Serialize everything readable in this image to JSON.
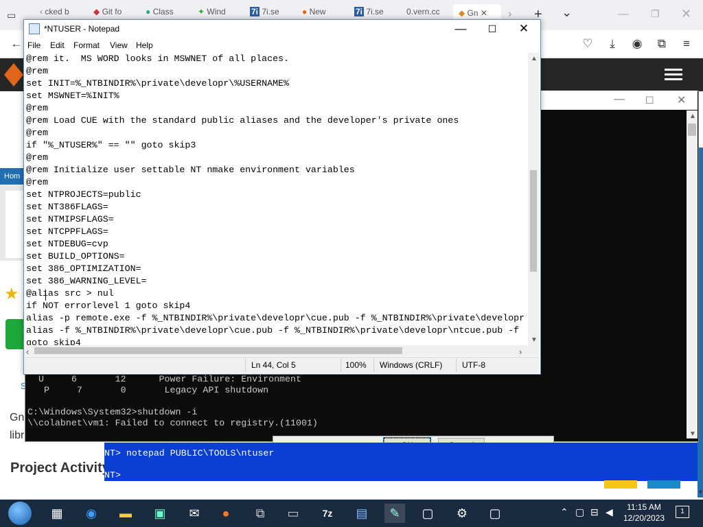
{
  "browser": {
    "tabs": [
      {
        "label": "cked b",
        "icon": "tab-favicon"
      },
      {
        "label": "Git fo",
        "icon": "github-icon"
      },
      {
        "label": "Class",
        "icon": "globe-icon"
      },
      {
        "label": "Wind",
        "icon": "leaf-icon"
      },
      {
        "label": "7i.se",
        "icon": "7z-icon"
      },
      {
        "label": "New",
        "icon": "firefox-icon"
      },
      {
        "label": "7i.se",
        "icon": "7z-icon"
      },
      {
        "label": "0.vern.cc",
        "icon": "tab-favicon"
      },
      {
        "label": "Gn",
        "icon": "gnu-icon"
      }
    ],
    "new_tab": "+",
    "tab_list": "⌄"
  },
  "background_page": {
    "home_link": "Hom",
    "s_link": "S",
    "gnu_text": "Gnu",
    "libr_text": "libr",
    "project_activity": "Project Activity"
  },
  "cmd": {
    "lines": [
      "  U     6       12      Power Failure: Environment",
      "   P     7       0       Legacy API shutdown",
      "",
      "C:\\Windows\\System32>shutdown -i",
      "\\\\colabnet\\vm1: Failed to connect to registry.(11001)"
    ]
  },
  "nt_console": {
    "line1": "NT> notepad PUBLIC\\TOOLS\\ntuser",
    "line2": "NT>"
  },
  "dialog": {
    "ok": "OK",
    "cancel": "Cancel"
  },
  "notepad": {
    "title": "*NTUSER - Notepad",
    "menu": [
      "File",
      "Edit",
      "Format",
      "View",
      "Help"
    ],
    "lines": [
      "@rem it.  MS WORD looks in MSWNET of all places.",
      "@rem",
      "set INIT=%_NTBINDIR%\\private\\developr\\%USERNAME%",
      "set MSWNET=%INIT%",
      "@rem",
      "@rem Load CUE with the standard public aliases and the developer's private ones",
      "@rem",
      "if \"%_NTUSER%\" == \"\" goto skip3",
      "@rem",
      "@rem Initialize user settable NT nmake environment variables",
      "@rem",
      "set NTPROJECTS=public",
      "set NT386FLAGS=",
      "set NTMIPSFLAGS=",
      "set NTCPPFLAGS=",
      "set NTDEBUG=cvp",
      "set BUILD_OPTIONS=",
      "set 386_OPTIMIZATION=",
      "set 386_WARNING_LEVEL=",
      "@alias src > nul",
      "if NOT errorlevel 1 goto skip4",
      "alias -p remote.exe -f %_NTBINDIR%\\private\\developr\\cue.pub -f %_NTBINDIR%\\private\\developr",
      "alias -f %_NTBINDIR%\\private\\developr\\cue.pub -f %_NTBINDIR%\\private\\developr\\ntcue.pub -f",
      "goto skip4"
    ],
    "status": {
      "position": "Ln 44, Col 5",
      "zoom": "100%",
      "line_ending": "Windows (CRLF)",
      "encoding": "UTF-8"
    }
  },
  "taskbar": {
    "time": "11:15 AM",
    "date": "12/20/2023",
    "notification_count": "1"
  }
}
